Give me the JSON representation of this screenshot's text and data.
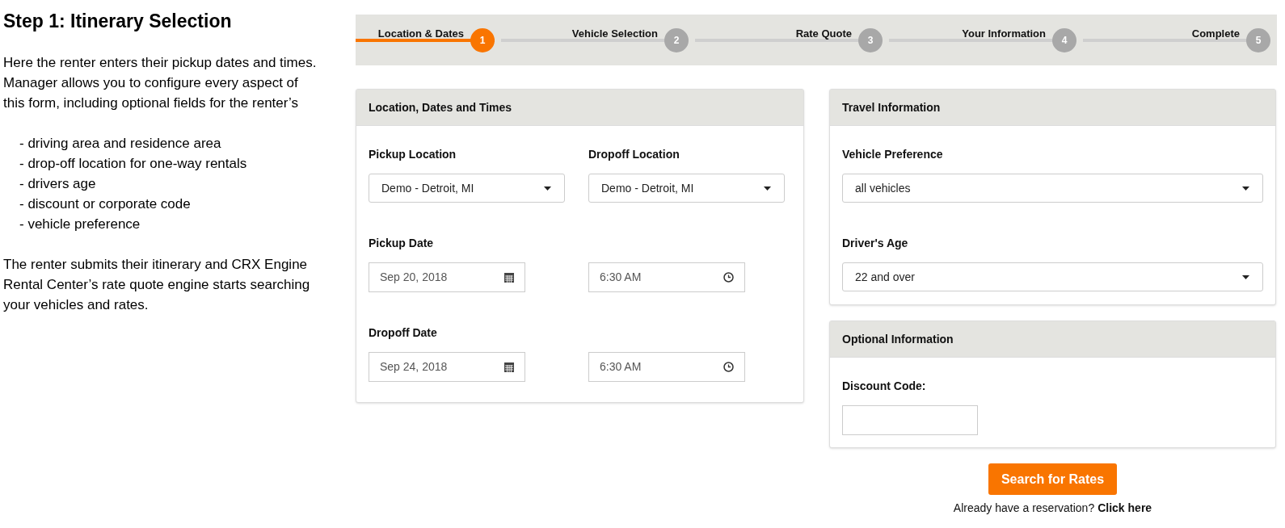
{
  "intro": {
    "title": "Step 1: Itinerary Selection",
    "paragraph": "Here the renter enters their pickup dates and times. Manager allows you to configure every aspect of this form, including optional fields for the renter’s",
    "list": [
      "- driving area and residence area",
      "- drop-off location for one-way rentals",
      "- drivers age",
      "- discount or corporate code",
      "- vehicle preference"
    ],
    "closing": "The renter submits their itinerary and CRX Engine Rental Center’s rate quote engine starts searching your vehicles and rates."
  },
  "steps": [
    {
      "label": "Location & Dates",
      "number": "1",
      "selected": true
    },
    {
      "label": "Vehicle Selection",
      "number": "2",
      "selected": false
    },
    {
      "label": "Rate Quote",
      "number": "3",
      "selected": false
    },
    {
      "label": "Your Information",
      "number": "4",
      "selected": false
    },
    {
      "label": "Complete",
      "number": "5",
      "selected": false
    }
  ],
  "location_panel": {
    "title": "Location, Dates and Times",
    "rows": [
      {
        "fields": [
          {
            "label": "Pickup Location",
            "kind": "select",
            "value": "Demo - Detroit, MI"
          },
          {
            "label": "Dropoff Location",
            "kind": "select",
            "value": "Demo - Detroit, MI"
          }
        ]
      },
      {
        "fields": [
          {
            "label": "Pickup Date",
            "kind": "date",
            "value": "Sep 20, 2018"
          },
          {
            "kind": "time",
            "value": "6:30 AM"
          }
        ]
      },
      {
        "fields": [
          {
            "label": "Dropoff Date",
            "kind": "date",
            "value": "Sep 24, 2018"
          },
          {
            "kind": "time",
            "value": "6:30 AM"
          }
        ]
      }
    ]
  },
  "travel_panel": {
    "title": "Travel Information",
    "fields": [
      {
        "label": "Vehicle Preference",
        "kind": "select",
        "value": "all vehicles"
      },
      {
        "label": "Driver's Age",
        "kind": "select",
        "value": "22 and over"
      }
    ]
  },
  "optional_panel": {
    "title": "Optional Information",
    "fields": [
      {
        "label": "Discount Code:",
        "kind": "text"
      }
    ]
  },
  "search_button": "Search for Rates",
  "reservation_prompt": {
    "text": "Already have a reservation?",
    "link": "Click here"
  }
}
